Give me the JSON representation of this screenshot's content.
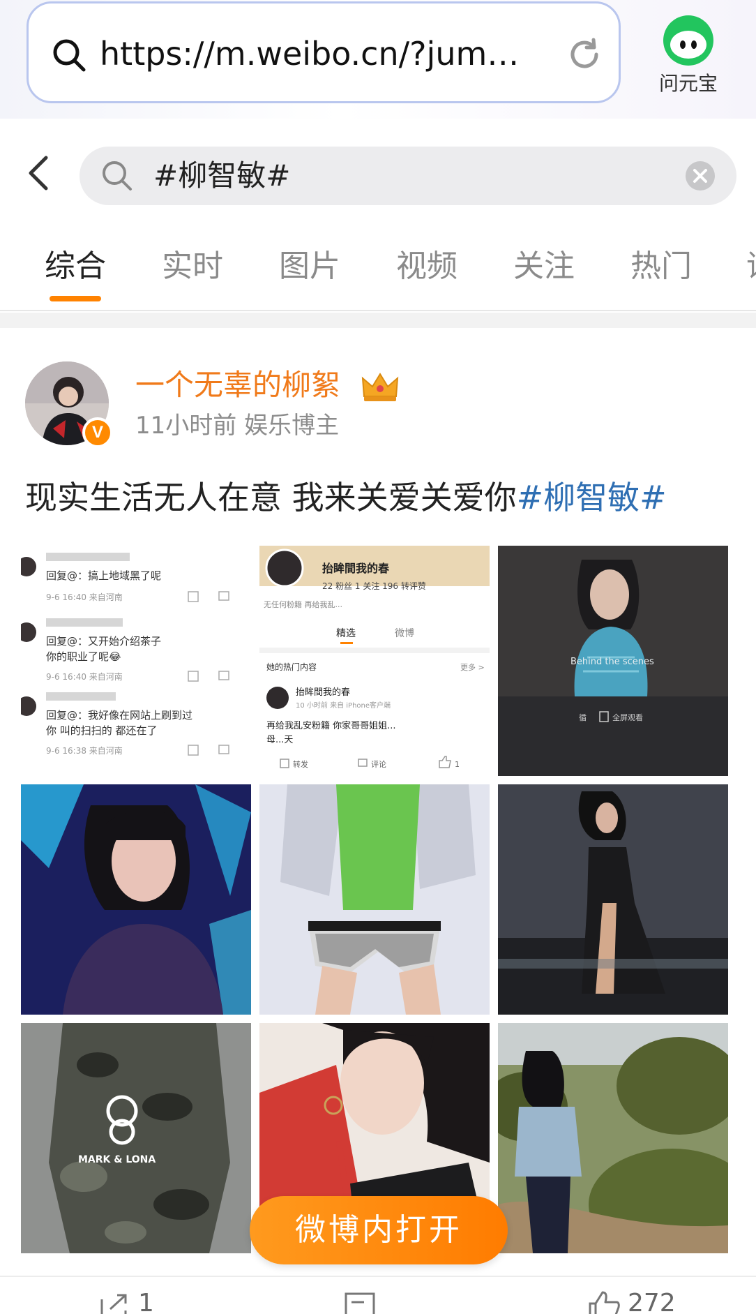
{
  "browser": {
    "url": "https://m.weibo.cn/?jum…",
    "assistant_label": "问元宝",
    "accent_border": "#b9c6ee"
  },
  "search": {
    "query": "#柳智敏#"
  },
  "tabs": [
    {
      "label": "综合",
      "active": true
    },
    {
      "label": "实时"
    },
    {
      "label": "图片"
    },
    {
      "label": "视频"
    },
    {
      "label": "关注"
    },
    {
      "label": "热门"
    },
    {
      "label": "话"
    }
  ],
  "post": {
    "username": "一个无辜的柳絮",
    "badge": "V",
    "meta": "11小时前 娱乐博主",
    "text": "现实生活无人在意 我来关爱关爱你",
    "hashtag": "#柳智敏#",
    "images": [
      {
        "kind": "comments-screenshot",
        "rows": [
          {
            "line1": "回复@：搞上地域黑了呢",
            "line2": "",
            "meta": "9-6 16:40 来自河南"
          },
          {
            "line1": "回复@：又开始介绍茶子",
            "line2": "你的职业了呢😂",
            "meta": "9-6 16:40 来自河南"
          },
          {
            "line1": "回复@：我好像在网站上刷到过",
            "line2": "你 叫的扫扫的 都还在了",
            "meta": "9-6 16:38 来自河南"
          }
        ]
      },
      {
        "kind": "profile-screenshot",
        "name": "抬眸間我的春",
        "stats": "22 粉丝   1 关注   196 转评赞",
        "bio": "无任何粉籍 再给我乱...",
        "tab1": "精选",
        "tab2": "微博",
        "section": "她的热门内容",
        "more": "更多 >",
        "post_name": "抬眸間我的春",
        "post_meta": "10 小时前  来自 iPhone客户端",
        "post_text": "再给我乱安粉籍 你家哥哥姐姐...",
        "post_text2": "母...天",
        "repost": "转发",
        "comment": "评论",
        "like": "1"
      },
      {
        "kind": "photo",
        "caption": "Behind the scenes",
        "btn1": "循",
        "btn2": "全屏观看"
      },
      {
        "kind": "photo"
      },
      {
        "kind": "photo"
      },
      {
        "kind": "photo"
      },
      {
        "kind": "photo",
        "brand": "MARK & LONA"
      },
      {
        "kind": "photo"
      },
      {
        "kind": "photo"
      }
    ]
  },
  "open_in_app": "微博内打开",
  "actions": {
    "repost_count": "1",
    "comment_count": "",
    "like_count": "272"
  },
  "colors": {
    "brand_orange": "#ff8200",
    "username": "#f07a1a",
    "hashtag": "#2f6fb3"
  }
}
